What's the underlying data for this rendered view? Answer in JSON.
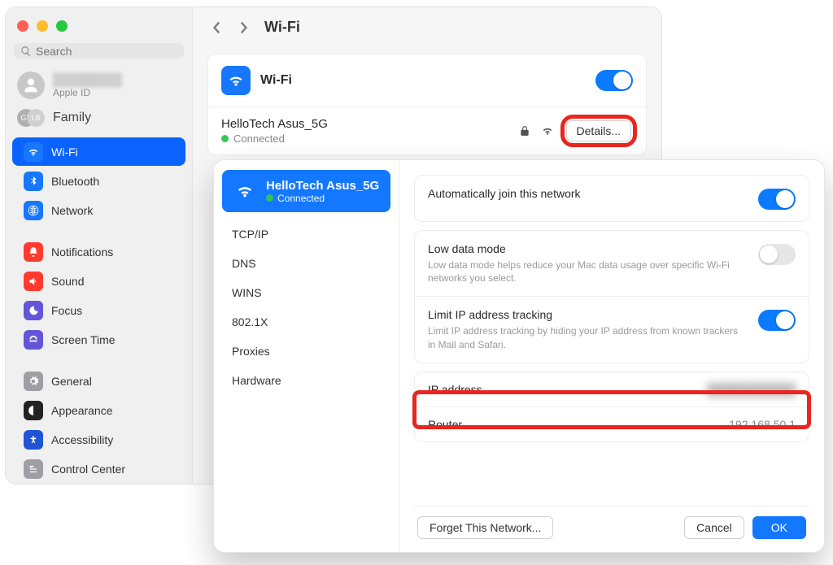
{
  "window": {
    "search_placeholder": "Search",
    "page_title": "Wi-Fi"
  },
  "account": {
    "sub": "Apple ID"
  },
  "family": {
    "label": "Family"
  },
  "sidebar": {
    "items": [
      {
        "label": "Wi-Fi"
      },
      {
        "label": "Bluetooth"
      },
      {
        "label": "Network"
      },
      {
        "label": "Notifications"
      },
      {
        "label": "Sound"
      },
      {
        "label": "Focus"
      },
      {
        "label": "Screen Time"
      },
      {
        "label": "General"
      },
      {
        "label": "Appearance"
      },
      {
        "label": "Accessibility"
      },
      {
        "label": "Control Center"
      }
    ]
  },
  "wifi": {
    "title": "Wi-Fi",
    "network_name": "HelloTech Asus_5G",
    "status": "Connected",
    "details_button": "Details..."
  },
  "modal": {
    "network_name": "HelloTech Asus_5G",
    "status": "Connected",
    "tabs": [
      {
        "label": "TCP/IP"
      },
      {
        "label": "DNS"
      },
      {
        "label": "WINS"
      },
      {
        "label": "802.1X"
      },
      {
        "label": "Proxies"
      },
      {
        "label": "Hardware"
      }
    ],
    "auto_join": "Automatically join this network",
    "low_data_title": "Low data mode",
    "low_data_desc": "Low data mode helps reduce your Mac data usage over specific Wi-Fi networks you select.",
    "limit_ip_title": "Limit IP address tracking",
    "limit_ip_desc": "Limit IP address tracking by hiding your IP address from known trackers in Mail and Safari.",
    "ip_label": "IP address",
    "router_label": "Router",
    "router_value": "192.168.50.1",
    "forget": "Forget This Network...",
    "cancel": "Cancel",
    "ok": "OK"
  }
}
